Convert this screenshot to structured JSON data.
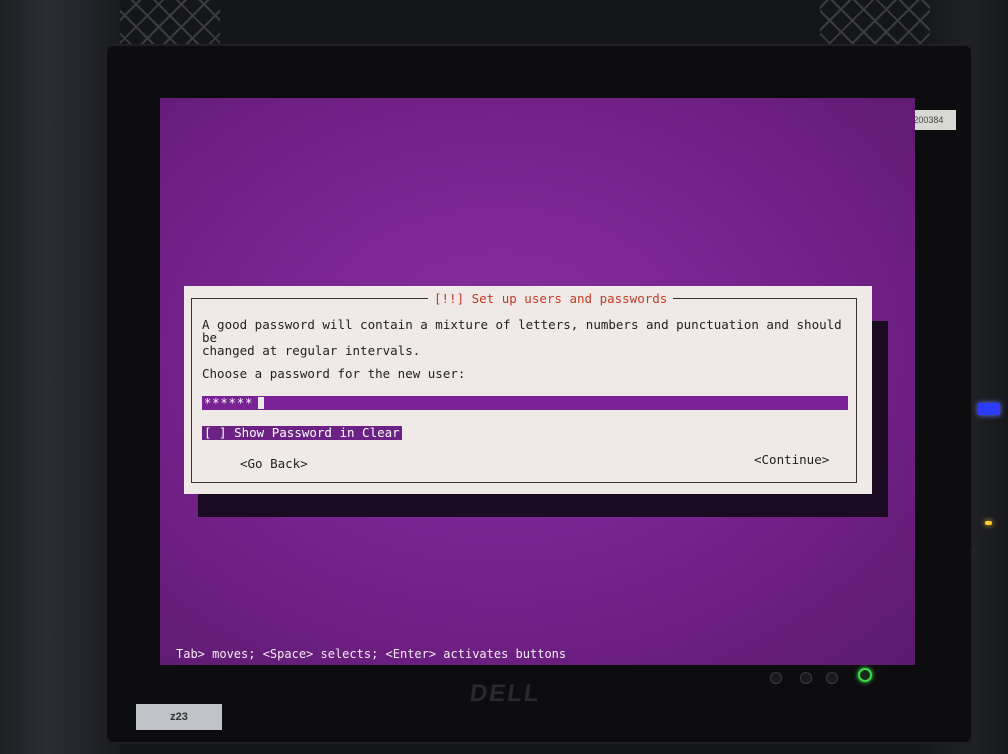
{
  "monitor": {
    "asset_tag": "LT040200384",
    "brand": "DELL",
    "bottom_sticker": "z23"
  },
  "dialog": {
    "title": "[!!] Set up users and passwords",
    "description": "A good password will contain a mixture of letters, numbers and punctuation and should be\nchanged at regular intervals.",
    "prompt": "Choose a password for the new user:",
    "password_field": {
      "masked_value": "******"
    },
    "show_password_checkbox": {
      "box": "[ ]",
      "label": "Show Password in Clear"
    },
    "go_back_label": "<Go Back>",
    "continue_label": "<Continue>"
  },
  "hint_bar": "Tab> moves; <Space> selects; <Enter> activates buttons",
  "colors": {
    "screen_background": "#6f1f86",
    "dialog_background": "#efeae8",
    "title_text": "#c43a26",
    "selected_field": "#7a2296",
    "power_led": "#3fd84a"
  },
  "icons": {
    "power": "power-icon"
  }
}
